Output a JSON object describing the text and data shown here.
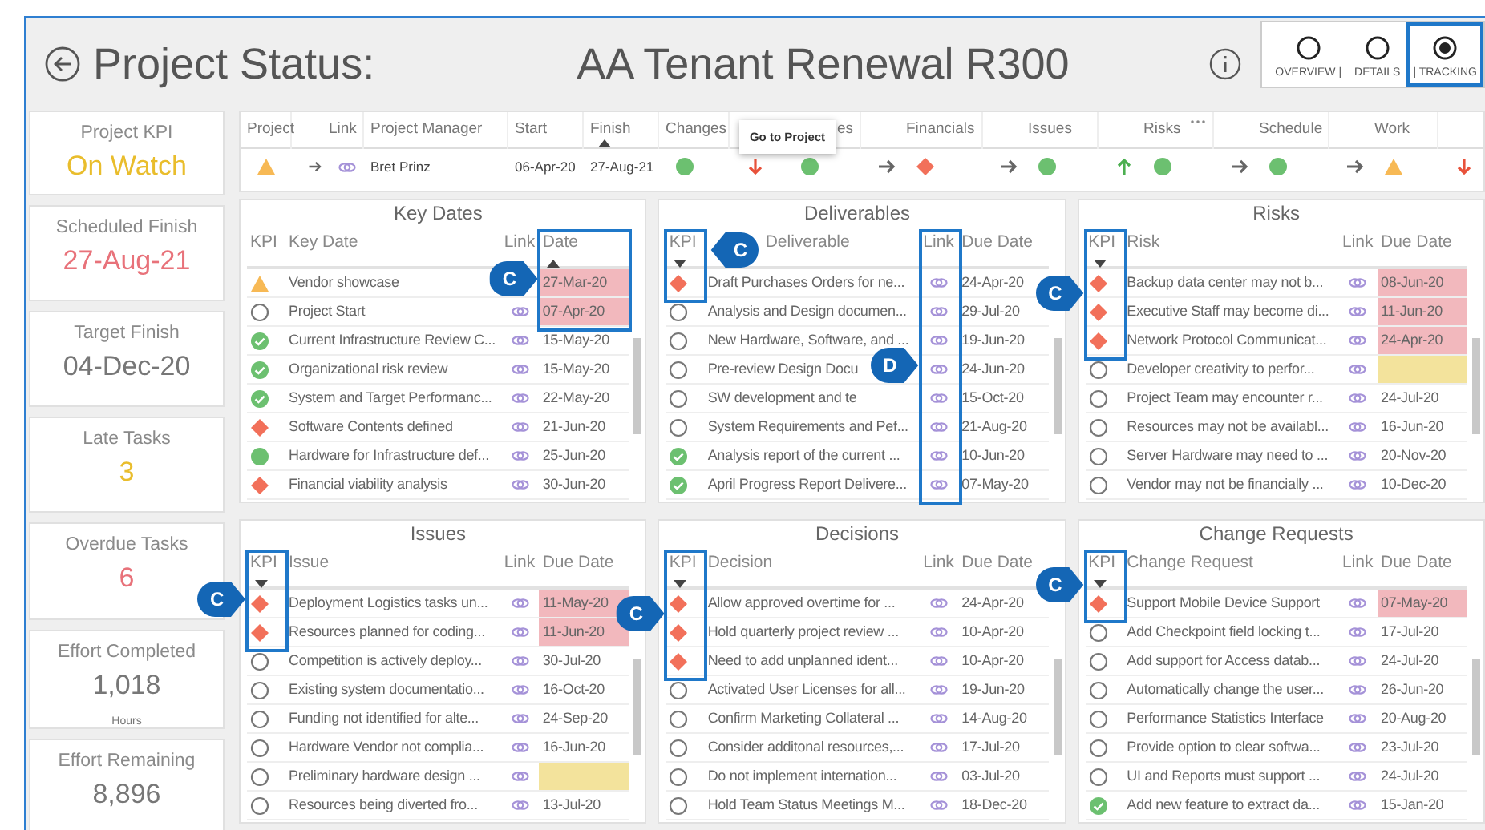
{
  "header": {
    "title": "Project Status:",
    "project": "AA Tenant Renewal R300"
  },
  "view_options": [
    {
      "label": "OVERVIEW |",
      "selected": false
    },
    {
      "label": "DETAILS",
      "selected": false
    },
    {
      "label": "| TRACKING",
      "selected": true,
      "boxed": true
    }
  ],
  "kpi_cards": [
    {
      "label": "Project KPI",
      "value": "On Watch",
      "color": "#e9bd2c"
    },
    {
      "label": "Scheduled Finish",
      "value": "27-Aug-21",
      "color": "#e8727a"
    },
    {
      "label": "Target Finish",
      "value": "04-Dec-20",
      "color": "#777777"
    },
    {
      "label": "Late Tasks",
      "value": "3",
      "color": "#e9bd2c"
    },
    {
      "label": "Overdue Tasks",
      "value": "6",
      "color": "#e8727a"
    },
    {
      "label": "Effort Completed",
      "value": "1,018",
      "unit": "Hours",
      "color": "#777777"
    },
    {
      "label": "Effort Remaining",
      "value": "8,896",
      "color": "#777777"
    }
  ],
  "project_row": {
    "columns": [
      {
        "label": "Project",
        "cell": {
          "kind": "warning"
        }
      },
      {
        "cell": {
          "kind": "arrow-right"
        }
      },
      {
        "label": "Link",
        "cell": {
          "kind": "link"
        }
      },
      {
        "label": "Project Manager",
        "cell": {
          "kind": "text",
          "text": "Bret Prinz"
        }
      },
      {
        "label": "Start",
        "cell": {
          "kind": "text",
          "text": "06-Apr-20"
        }
      },
      {
        "label": "Finish",
        "sorted": true,
        "descending": false,
        "cell": {
          "kind": "text",
          "text": "27-Aug-21"
        }
      },
      {
        "label": "Changes",
        "cell": {
          "kind": "ok"
        }
      },
      {
        "cell": {
          "kind": "arrow-down"
        },
        "tooltip": "Go to Project"
      },
      {
        "label": "es",
        "cell": {
          "kind": "ok"
        }
      },
      {
        "cell": {
          "kind": "arrow-right"
        }
      },
      {
        "label": "Financials",
        "cell": {
          "kind": "late"
        }
      },
      {
        "cell": {
          "kind": "arrow-right"
        }
      },
      {
        "label": "Issues",
        "cell": {
          "kind": "ok"
        }
      },
      {
        "cell": {
          "kind": "arrow-up"
        }
      },
      {
        "label": "Risks",
        "more": true,
        "cell": {
          "kind": "ok"
        }
      },
      {
        "cell": {
          "kind": "arrow-right"
        }
      },
      {
        "label": "Schedule",
        "cell": {
          "kind": "ok"
        }
      },
      {
        "cell": {
          "kind": "arrow-right"
        }
      },
      {
        "label": "Work",
        "cell": {
          "kind": "warning"
        }
      },
      {
        "cell": {
          "kind": "arrow-down"
        }
      }
    ]
  },
  "panels": [
    {
      "title": "Key Dates",
      "columns": [
        {
          "label": "KPI"
        },
        {
          "label": "Key Date"
        },
        {
          "label": "Link"
        },
        {
          "label": "Date",
          "sorted": true,
          "descending": false,
          "boxed": true,
          "callout": {
            "label": "C",
            "on_right": false
          }
        }
      ],
      "rows": [
        {
          "kind": "warning",
          "name": "Vendor showcase",
          "date": "27-Mar-20",
          "overdue": true,
          "date_boxed": true
        },
        {
          "kind": "empty",
          "name": "Project Start",
          "date": "07-Apr-20",
          "overdue": true,
          "date_boxed": true
        },
        {
          "kind": "done",
          "name": "Current Infrastructure Review C...",
          "date": "15-May-20"
        },
        {
          "kind": "done",
          "name": "Organizational risk review",
          "date": "15-May-20"
        },
        {
          "kind": "done",
          "name": "System and Target Performanc...",
          "date": "22-May-20"
        },
        {
          "kind": "late",
          "name": "Software Contents defined",
          "date": "21-Jun-20"
        },
        {
          "kind": "ok",
          "name": "Hardware for Infrastructure def...",
          "date": "25-Jun-20"
        },
        {
          "kind": "late",
          "name": "Financial viability analysis",
          "date": "30-Jun-20"
        }
      ]
    },
    {
      "title": "Deliverables",
      "columns": [
        {
          "label": "KPI",
          "sorted": true,
          "descending": true,
          "boxed": true,
          "callout": {
            "label": "C",
            "on_right": true
          }
        },
        {
          "label": "Deliverable"
        },
        {
          "label": "Link",
          "boxed": true,
          "full_height": true,
          "callout": {
            "label": "D",
            "on_right": false
          }
        },
        {
          "label": "Due Date"
        }
      ],
      "rows": [
        {
          "kind": "late",
          "name": "Draft Purchases Orders for ne...",
          "date": "24-Apr-20",
          "kpi_boxed": true
        },
        {
          "kind": "empty",
          "name": "Analysis and Design documen...",
          "date": "29-Jul-20"
        },
        {
          "kind": "empty",
          "name": "New Hardware, Software, and ...",
          "date": "19-Jun-20"
        },
        {
          "kind": "empty",
          "name": "Pre-review Design Docu",
          "date": "24-Jun-20"
        },
        {
          "kind": "empty",
          "name": "SW development and te",
          "date": "15-Oct-20"
        },
        {
          "kind": "empty",
          "name": "System Requirements and Pef...",
          "date": "21-Aug-20"
        },
        {
          "kind": "done",
          "name": "Analysis report of the current ...",
          "date": "10-Jun-20"
        },
        {
          "kind": "done",
          "name": "April Progress Report Delivere...",
          "date": "07-May-20"
        }
      ]
    },
    {
      "title": "Risks",
      "columns": [
        {
          "label": "KPI",
          "sorted": true,
          "descending": true,
          "boxed": true,
          "callout": {
            "label": "C",
            "on_right": false
          }
        },
        {
          "label": "Risk"
        },
        {
          "label": "Link"
        },
        {
          "label": "Due Date"
        }
      ],
      "rows": [
        {
          "kind": "late",
          "name": "Backup data center may not b...",
          "date": "08-Jun-20",
          "overdue": true,
          "kpi_boxed": true
        },
        {
          "kind": "late",
          "name": "Executive Staff may become di...",
          "date": "11-Jun-20",
          "overdue": true,
          "kpi_boxed": true
        },
        {
          "kind": "late",
          "name": "Network Protocol Communicat...",
          "date": "24-Apr-20",
          "overdue": true,
          "kpi_boxed": true
        },
        {
          "kind": "empty",
          "name": "Developer creativity to perfor...",
          "date_missing": true
        },
        {
          "kind": "empty",
          "name": "Project Team may encounter r...",
          "date": "24-Jul-20"
        },
        {
          "kind": "empty",
          "name": "Resources may not be availabl...",
          "date": "16-Jun-20"
        },
        {
          "kind": "empty",
          "name": "Server Hardware may need to ...",
          "date": "20-Nov-20"
        },
        {
          "kind": "empty",
          "name": "Vendor may not be financially ...",
          "date": "10-Dec-20"
        }
      ]
    },
    {
      "title": "Issues",
      "columns": [
        {
          "label": "KPI",
          "sorted": true,
          "descending": true,
          "boxed": true,
          "callout": {
            "label": "C",
            "on_right": false
          }
        },
        {
          "label": "Issue"
        },
        {
          "label": "Link"
        },
        {
          "label": "Due Date"
        }
      ],
      "rows": [
        {
          "kind": "late",
          "name": "Deployment Logistics tasks un...",
          "date": "11-May-20",
          "overdue": true,
          "kpi_boxed": true
        },
        {
          "kind": "late",
          "name": "Resources planned for coding...",
          "date": "11-Jun-20",
          "overdue": true,
          "kpi_boxed": true
        },
        {
          "kind": "empty",
          "name": "Competition is actively deploy...",
          "date": "30-Jul-20"
        },
        {
          "kind": "empty",
          "name": "Existing system documentatio...",
          "date": "16-Oct-20"
        },
        {
          "kind": "empty",
          "name": "Funding not identified for alte...",
          "date": "24-Sep-20"
        },
        {
          "kind": "empty",
          "name": "Hardware Vendor not complia...",
          "date": "16-Jun-20"
        },
        {
          "kind": "empty",
          "name": "Preliminary hardware design ...",
          "date_missing": true
        },
        {
          "kind": "empty",
          "name": "Resources being diverted fro...",
          "date": "13-Jul-20"
        }
      ]
    },
    {
      "title": "Decisions",
      "columns": [
        {
          "label": "KPI",
          "sorted": true,
          "descending": true,
          "boxed": true,
          "callout": {
            "label": "C",
            "on_right": false
          }
        },
        {
          "label": "Decision"
        },
        {
          "label": "Link"
        },
        {
          "label": "Due Date"
        }
      ],
      "rows": [
        {
          "kind": "late",
          "name": "Allow approved overtime for ...",
          "date": "24-Apr-20",
          "kpi_boxed": true
        },
        {
          "kind": "late",
          "name": "Hold quarterly project review ...",
          "date": "10-Apr-20",
          "kpi_boxed": true
        },
        {
          "kind": "late",
          "name": "Need to add unplanned ident...",
          "date": "10-Apr-20",
          "kpi_boxed": true
        },
        {
          "kind": "empty",
          "name": "Activated User Licenses for all...",
          "date": "19-Jun-20"
        },
        {
          "kind": "empty",
          "name": "Confirm Marketing Collateral ...",
          "date": "14-Aug-20"
        },
        {
          "kind": "empty",
          "name": "Consider additonal resources,...",
          "date": "17-Jul-20"
        },
        {
          "kind": "empty",
          "name": "Do not implement internation...",
          "date": "03-Jul-20"
        },
        {
          "kind": "empty",
          "name": "Hold Team Status Meetings M...",
          "date": "18-Dec-20"
        }
      ]
    },
    {
      "title": "Change Requests",
      "columns": [
        {
          "label": "KPI",
          "sorted": true,
          "descending": true,
          "boxed": true,
          "callout": {
            "label": "C",
            "on_right": false
          }
        },
        {
          "label": "Change Request"
        },
        {
          "label": "Link"
        },
        {
          "label": "Due Date"
        }
      ],
      "rows": [
        {
          "kind": "late",
          "name": "Support Mobile Device Support",
          "date": "07-May-20",
          "overdue": true,
          "kpi_boxed": true
        },
        {
          "kind": "empty",
          "name": "Add Checkpoint field locking t...",
          "date": "17-Jul-20"
        },
        {
          "kind": "empty",
          "name": "Add support for Access datab...",
          "date": "24-Jul-20"
        },
        {
          "kind": "empty",
          "name": "Automatically change the user...",
          "date": "26-Jun-20"
        },
        {
          "kind": "empty",
          "name": "Performance Statistics Interface",
          "date": "20-Aug-20"
        },
        {
          "kind": "empty",
          "name": "Provide option to clear softwa...",
          "date": "23-Jul-20"
        },
        {
          "kind": "empty",
          "name": "UI and Reports must support ...",
          "date": "24-Jul-20"
        },
        {
          "kind": "done",
          "name": "Add new feature to extract da...",
          "date": "15-Jan-20"
        }
      ]
    }
  ]
}
